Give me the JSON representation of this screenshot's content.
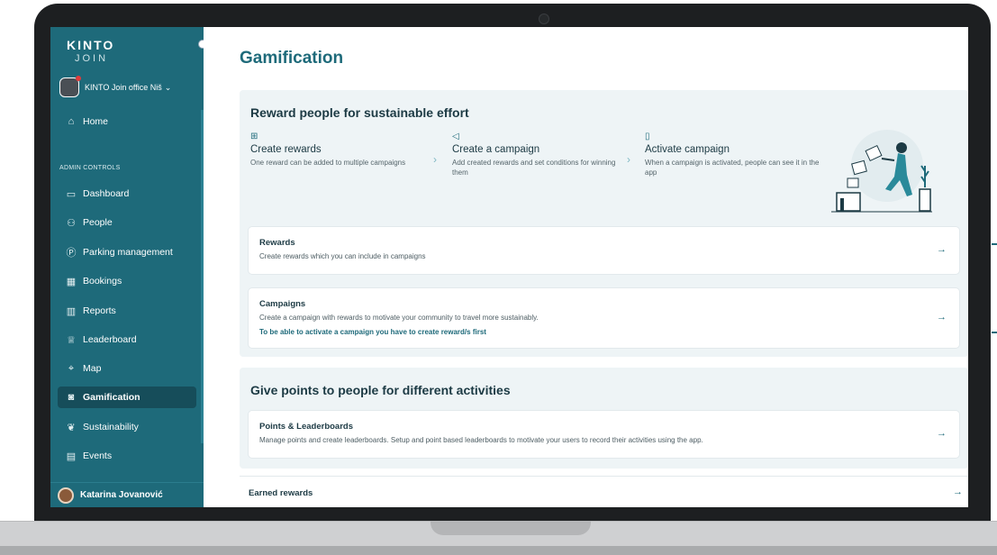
{
  "brand": {
    "logo_top": "KINTO",
    "logo_bottom": "JOIN",
    "accent": "#1e6a7a"
  },
  "office": {
    "name": "KINTO Join office Niš",
    "chevron_icon": "chevron-down-icon"
  },
  "sidebar": {
    "home_label": "Home",
    "section_label": "ADMIN CONTROLS",
    "items": [
      {
        "label": "Dashboard",
        "icon": "dashboard-icon"
      },
      {
        "label": "People",
        "icon": "people-icon"
      },
      {
        "label": "Parking management",
        "icon": "parking-icon"
      },
      {
        "label": "Bookings",
        "icon": "bookings-icon"
      },
      {
        "label": "Reports",
        "icon": "reports-icon"
      },
      {
        "label": "Leaderboard",
        "icon": "leaderboard-icon"
      },
      {
        "label": "Map",
        "icon": "map-icon"
      },
      {
        "label": "Gamification",
        "icon": "gamepad-icon",
        "active": true
      },
      {
        "label": "Sustainability",
        "icon": "leaf-icon"
      },
      {
        "label": "Events",
        "icon": "calendar-icon"
      }
    ],
    "user_name": "Katarina Jovanović"
  },
  "main": {
    "title": "Gamification",
    "reward_section": {
      "heading": "Reward people for sustainable effort",
      "steps": [
        {
          "title": "Create rewards",
          "description": "One reward can be added to multiple campaigns",
          "icon": "gift-icon"
        },
        {
          "title": "Create a campaign",
          "description": "Add created rewards and set conditions for winning them",
          "icon": "megaphone-icon"
        },
        {
          "title": "Activate campaign",
          "description": "When a campaign is activated, people can see it in the app",
          "icon": "phone-icon"
        }
      ],
      "cards": [
        {
          "title": "Rewards",
          "description": "Create rewards which you can include in campaigns"
        },
        {
          "title": "Campaigns",
          "description": "Create a campaign with rewards to motivate your community to travel more sustainably.",
          "warning": "To be able to activate a campaign you have to create reward/s first"
        }
      ]
    },
    "points_section": {
      "heading": "Give points to people for different activities",
      "cards": [
        {
          "title": "Points & Leaderboards",
          "description": "Manage points and create leaderboards. Setup and point based leaderboards to motivate your users to record their activities using the app."
        }
      ]
    },
    "earned": {
      "title": "Earned rewards"
    }
  }
}
